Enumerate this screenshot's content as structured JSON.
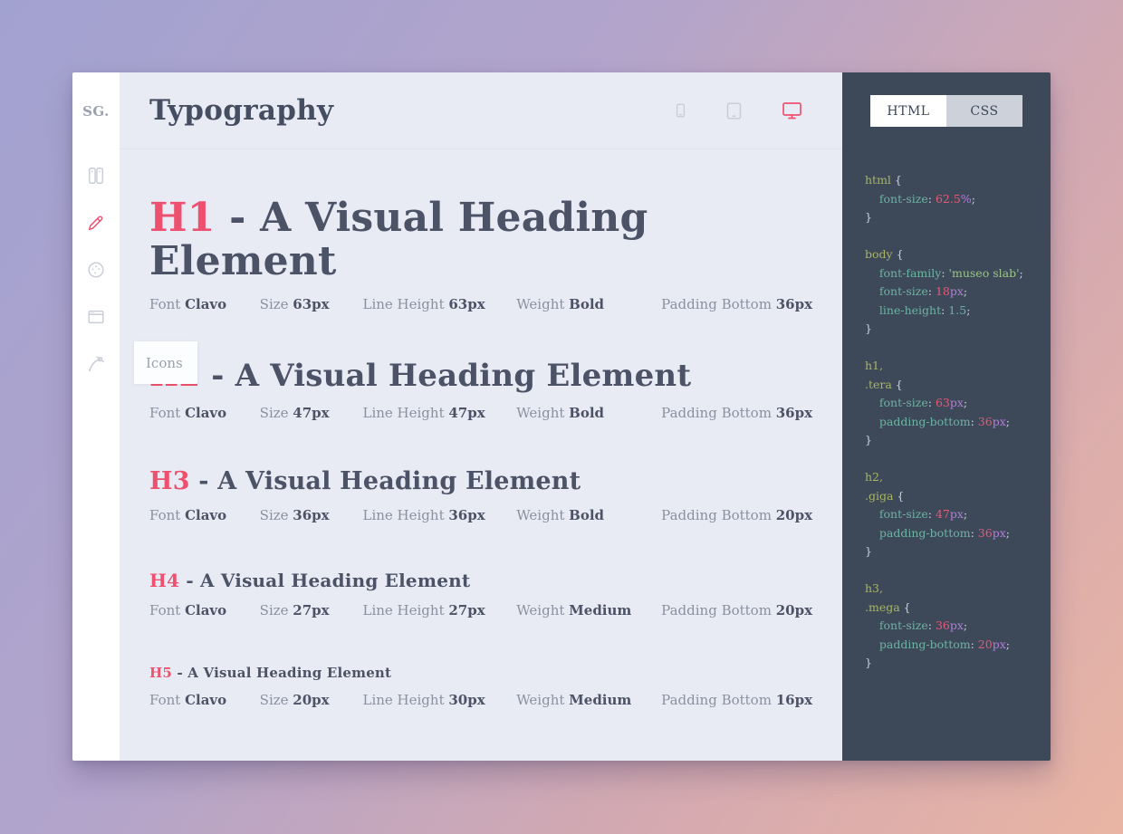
{
  "app": {
    "accent_color": "#ee5170",
    "panel_color": "#3d4859",
    "main_bg_color": "#e9ebf4"
  },
  "sidebar": {
    "logo": "SG.",
    "tooltip": "Icons",
    "items": [
      {
        "id": "swatches",
        "icon": "swatches-icon",
        "active": false
      },
      {
        "id": "typography",
        "icon": "pencil-icon",
        "active": true
      },
      {
        "id": "colors",
        "icon": "palette-icon",
        "active": false
      },
      {
        "id": "layout",
        "icon": "browser-window-icon",
        "active": false
      },
      {
        "id": "icons",
        "icon": "pen-tool-icon",
        "active": false
      }
    ]
  },
  "header": {
    "title": "Typography",
    "devices": [
      {
        "id": "mobile",
        "icon": "mobile-icon",
        "active": false
      },
      {
        "id": "tablet",
        "icon": "tablet-icon",
        "active": false
      },
      {
        "id": "desktop",
        "icon": "desktop-icon",
        "active": true
      }
    ]
  },
  "specimens": [
    {
      "tag": "H1",
      "text": " - A Visual Heading Element",
      "meta": [
        {
          "label": "Font",
          "value": "Clavo"
        },
        {
          "label": "Size",
          "value": "63px"
        },
        {
          "label": "Line Height",
          "value": "63px"
        },
        {
          "label": "Weight",
          "value": "Bold"
        },
        {
          "label": "Padding Bottom",
          "value": "36px"
        }
      ]
    },
    {
      "tag": "H2",
      "text": " - A Visual Heading Element",
      "meta": [
        {
          "label": "Font",
          "value": "Clavo"
        },
        {
          "label": "Size",
          "value": "47px"
        },
        {
          "label": "Line Height",
          "value": "47px"
        },
        {
          "label": "Weight",
          "value": "Bold"
        },
        {
          "label": "Padding Bottom",
          "value": "36px"
        }
      ]
    },
    {
      "tag": "H3",
      "text": " - A Visual Heading Element",
      "meta": [
        {
          "label": "Font",
          "value": "Clavo"
        },
        {
          "label": "Size",
          "value": "36px"
        },
        {
          "label": "Line Height",
          "value": "36px"
        },
        {
          "label": "Weight",
          "value": "Bold"
        },
        {
          "label": "Padding Bottom",
          "value": "20px"
        }
      ]
    },
    {
      "tag": "H4",
      "text": " - A Visual Heading Element",
      "meta": [
        {
          "label": "Font",
          "value": "Clavo"
        },
        {
          "label": "Size",
          "value": "27px"
        },
        {
          "label": "Line Height",
          "value": "27px"
        },
        {
          "label": "Weight",
          "value": "Medium"
        },
        {
          "label": "Padding Bottom",
          "value": "20px"
        }
      ]
    },
    {
      "tag": "H5",
      "text": " - A Visual Heading Element",
      "meta": [
        {
          "label": "Font",
          "value": "Clavo"
        },
        {
          "label": "Size",
          "value": "20px"
        },
        {
          "label": "Line Height",
          "value": "30px"
        },
        {
          "label": "Weight",
          "value": "Medium"
        },
        {
          "label": "Padding Bottom",
          "value": "16px"
        }
      ]
    }
  ],
  "code_panel": {
    "tabs": [
      {
        "label": "HTML",
        "active": true
      },
      {
        "label": "CSS",
        "active": false
      }
    ],
    "lines": [
      [
        {
          "t": "html ",
          "c": "sel"
        },
        {
          "t": "{",
          "c": "punc"
        }
      ],
      [
        {
          "t": "    ",
          "c": "punc"
        },
        {
          "t": "font-size",
          "c": "prop"
        },
        {
          "t": ": ",
          "c": "punc"
        },
        {
          "t": "62.5",
          "c": "num"
        },
        {
          "t": "%",
          "c": "unit"
        },
        {
          "t": ";",
          "c": "punc"
        }
      ],
      [
        {
          "t": "}",
          "c": "punc"
        }
      ],
      [],
      [
        {
          "t": "body ",
          "c": "sel"
        },
        {
          "t": "{",
          "c": "punc"
        }
      ],
      [
        {
          "t": "    ",
          "c": "punc"
        },
        {
          "t": "font-family",
          "c": "prop"
        },
        {
          "t": ": ",
          "c": "punc"
        },
        {
          "t": "'museo slab'",
          "c": "str"
        },
        {
          "t": ";",
          "c": "punc"
        }
      ],
      [
        {
          "t": "    ",
          "c": "punc"
        },
        {
          "t": "font-size",
          "c": "prop"
        },
        {
          "t": ": ",
          "c": "punc"
        },
        {
          "t": "18",
          "c": "num"
        },
        {
          "t": "px",
          "c": "unit"
        },
        {
          "t": ";",
          "c": "punc"
        }
      ],
      [
        {
          "t": "    ",
          "c": "punc"
        },
        {
          "t": "line-height",
          "c": "prop"
        },
        {
          "t": ": ",
          "c": "punc"
        },
        {
          "t": "1.5",
          "c": "val"
        },
        {
          "t": ";",
          "c": "punc"
        }
      ],
      [
        {
          "t": "}",
          "c": "punc"
        }
      ],
      [],
      [
        {
          "t": "h1,",
          "c": "sel"
        }
      ],
      [
        {
          "t": ".tera ",
          "c": "sel"
        },
        {
          "t": "{",
          "c": "punc"
        }
      ],
      [
        {
          "t": "    ",
          "c": "punc"
        },
        {
          "t": "font-size",
          "c": "prop"
        },
        {
          "t": ": ",
          "c": "punc"
        },
        {
          "t": "63",
          "c": "num"
        },
        {
          "t": "px",
          "c": "unit"
        },
        {
          "t": ";",
          "c": "punc"
        }
      ],
      [
        {
          "t": "    ",
          "c": "punc"
        },
        {
          "t": "padding-bottom",
          "c": "prop"
        },
        {
          "t": ": ",
          "c": "punc"
        },
        {
          "t": "36",
          "c": "num"
        },
        {
          "t": "px",
          "c": "unit"
        },
        {
          "t": ";",
          "c": "punc"
        }
      ],
      [
        {
          "t": "}",
          "c": "punc"
        }
      ],
      [],
      [
        {
          "t": "h2,",
          "c": "sel"
        }
      ],
      [
        {
          "t": ".giga ",
          "c": "sel"
        },
        {
          "t": "{",
          "c": "punc"
        }
      ],
      [
        {
          "t": "    ",
          "c": "punc"
        },
        {
          "t": "font-size",
          "c": "prop"
        },
        {
          "t": ": ",
          "c": "punc"
        },
        {
          "t": "47",
          "c": "num"
        },
        {
          "t": "px",
          "c": "unit"
        },
        {
          "t": ";",
          "c": "punc"
        }
      ],
      [
        {
          "t": "    ",
          "c": "punc"
        },
        {
          "t": "padding-bottom",
          "c": "prop"
        },
        {
          "t": ": ",
          "c": "punc"
        },
        {
          "t": "36",
          "c": "num"
        },
        {
          "t": "px",
          "c": "unit"
        },
        {
          "t": ";",
          "c": "punc"
        }
      ],
      [
        {
          "t": "}",
          "c": "punc"
        }
      ],
      [],
      [
        {
          "t": "h3,",
          "c": "sel"
        }
      ],
      [
        {
          "t": ".mega ",
          "c": "sel"
        },
        {
          "t": "{",
          "c": "punc"
        }
      ],
      [
        {
          "t": "    ",
          "c": "punc"
        },
        {
          "t": "font-size",
          "c": "prop"
        },
        {
          "t": ": ",
          "c": "punc"
        },
        {
          "t": "36",
          "c": "num"
        },
        {
          "t": "px",
          "c": "unit"
        },
        {
          "t": ";",
          "c": "punc"
        }
      ],
      [
        {
          "t": "    ",
          "c": "punc"
        },
        {
          "t": "padding-bottom",
          "c": "prop"
        },
        {
          "t": ": ",
          "c": "punc"
        },
        {
          "t": "20",
          "c": "num"
        },
        {
          "t": "px",
          "c": "unit"
        },
        {
          "t": ";",
          "c": "punc"
        }
      ],
      [
        {
          "t": "}",
          "c": "punc"
        }
      ]
    ]
  }
}
